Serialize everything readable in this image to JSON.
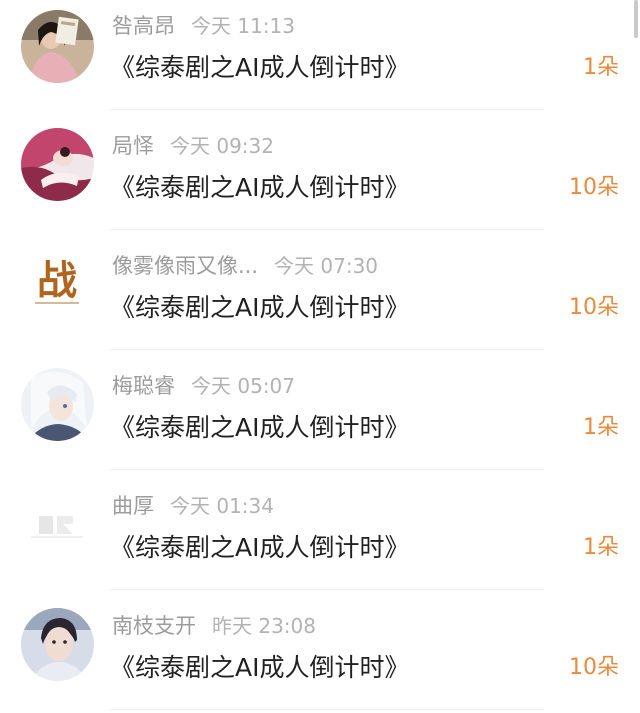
{
  "feed": {
    "items": [
      {
        "name": "咎高昂",
        "time": "今天 11:13",
        "title": "《综泰剧之AI成人倒计时》",
        "count": "1朵",
        "avatar": "woman-with-book-avatar"
      },
      {
        "name": "局怿",
        "time": "今天 09:32",
        "title": "《综泰剧之AI成人倒计时》",
        "count": "10朵",
        "avatar": "anime-figure-avatar"
      },
      {
        "name": "像雾像雨又像...",
        "time": "今天 07:30",
        "title": "《综泰剧之AI成人倒计时》",
        "count": "10朵",
        "avatar": "calligraphy-zhan-avatar"
      },
      {
        "name": "梅聪睿",
        "time": "今天 05:07",
        "title": "《综泰剧之AI成人倒计时》",
        "count": "1朵",
        "avatar": "white-haired-anime-avatar"
      },
      {
        "name": "曲厚",
        "time": "今天 01:34",
        "title": "《综泰剧之AI成人倒计时》",
        "count": "1朵",
        "avatar": "faded-logo-avatar"
      },
      {
        "name": "南枝支开",
        "time": "昨天 23:08",
        "title": "《综泰剧之AI成人倒计时》",
        "count": "10朵",
        "avatar": "man-portrait-avatar"
      }
    ],
    "avatar_text": {
      "zhan": "战"
    },
    "colors": {
      "count": "#e98a3c",
      "title": "#222222",
      "meta": "#a8a8a8"
    }
  }
}
